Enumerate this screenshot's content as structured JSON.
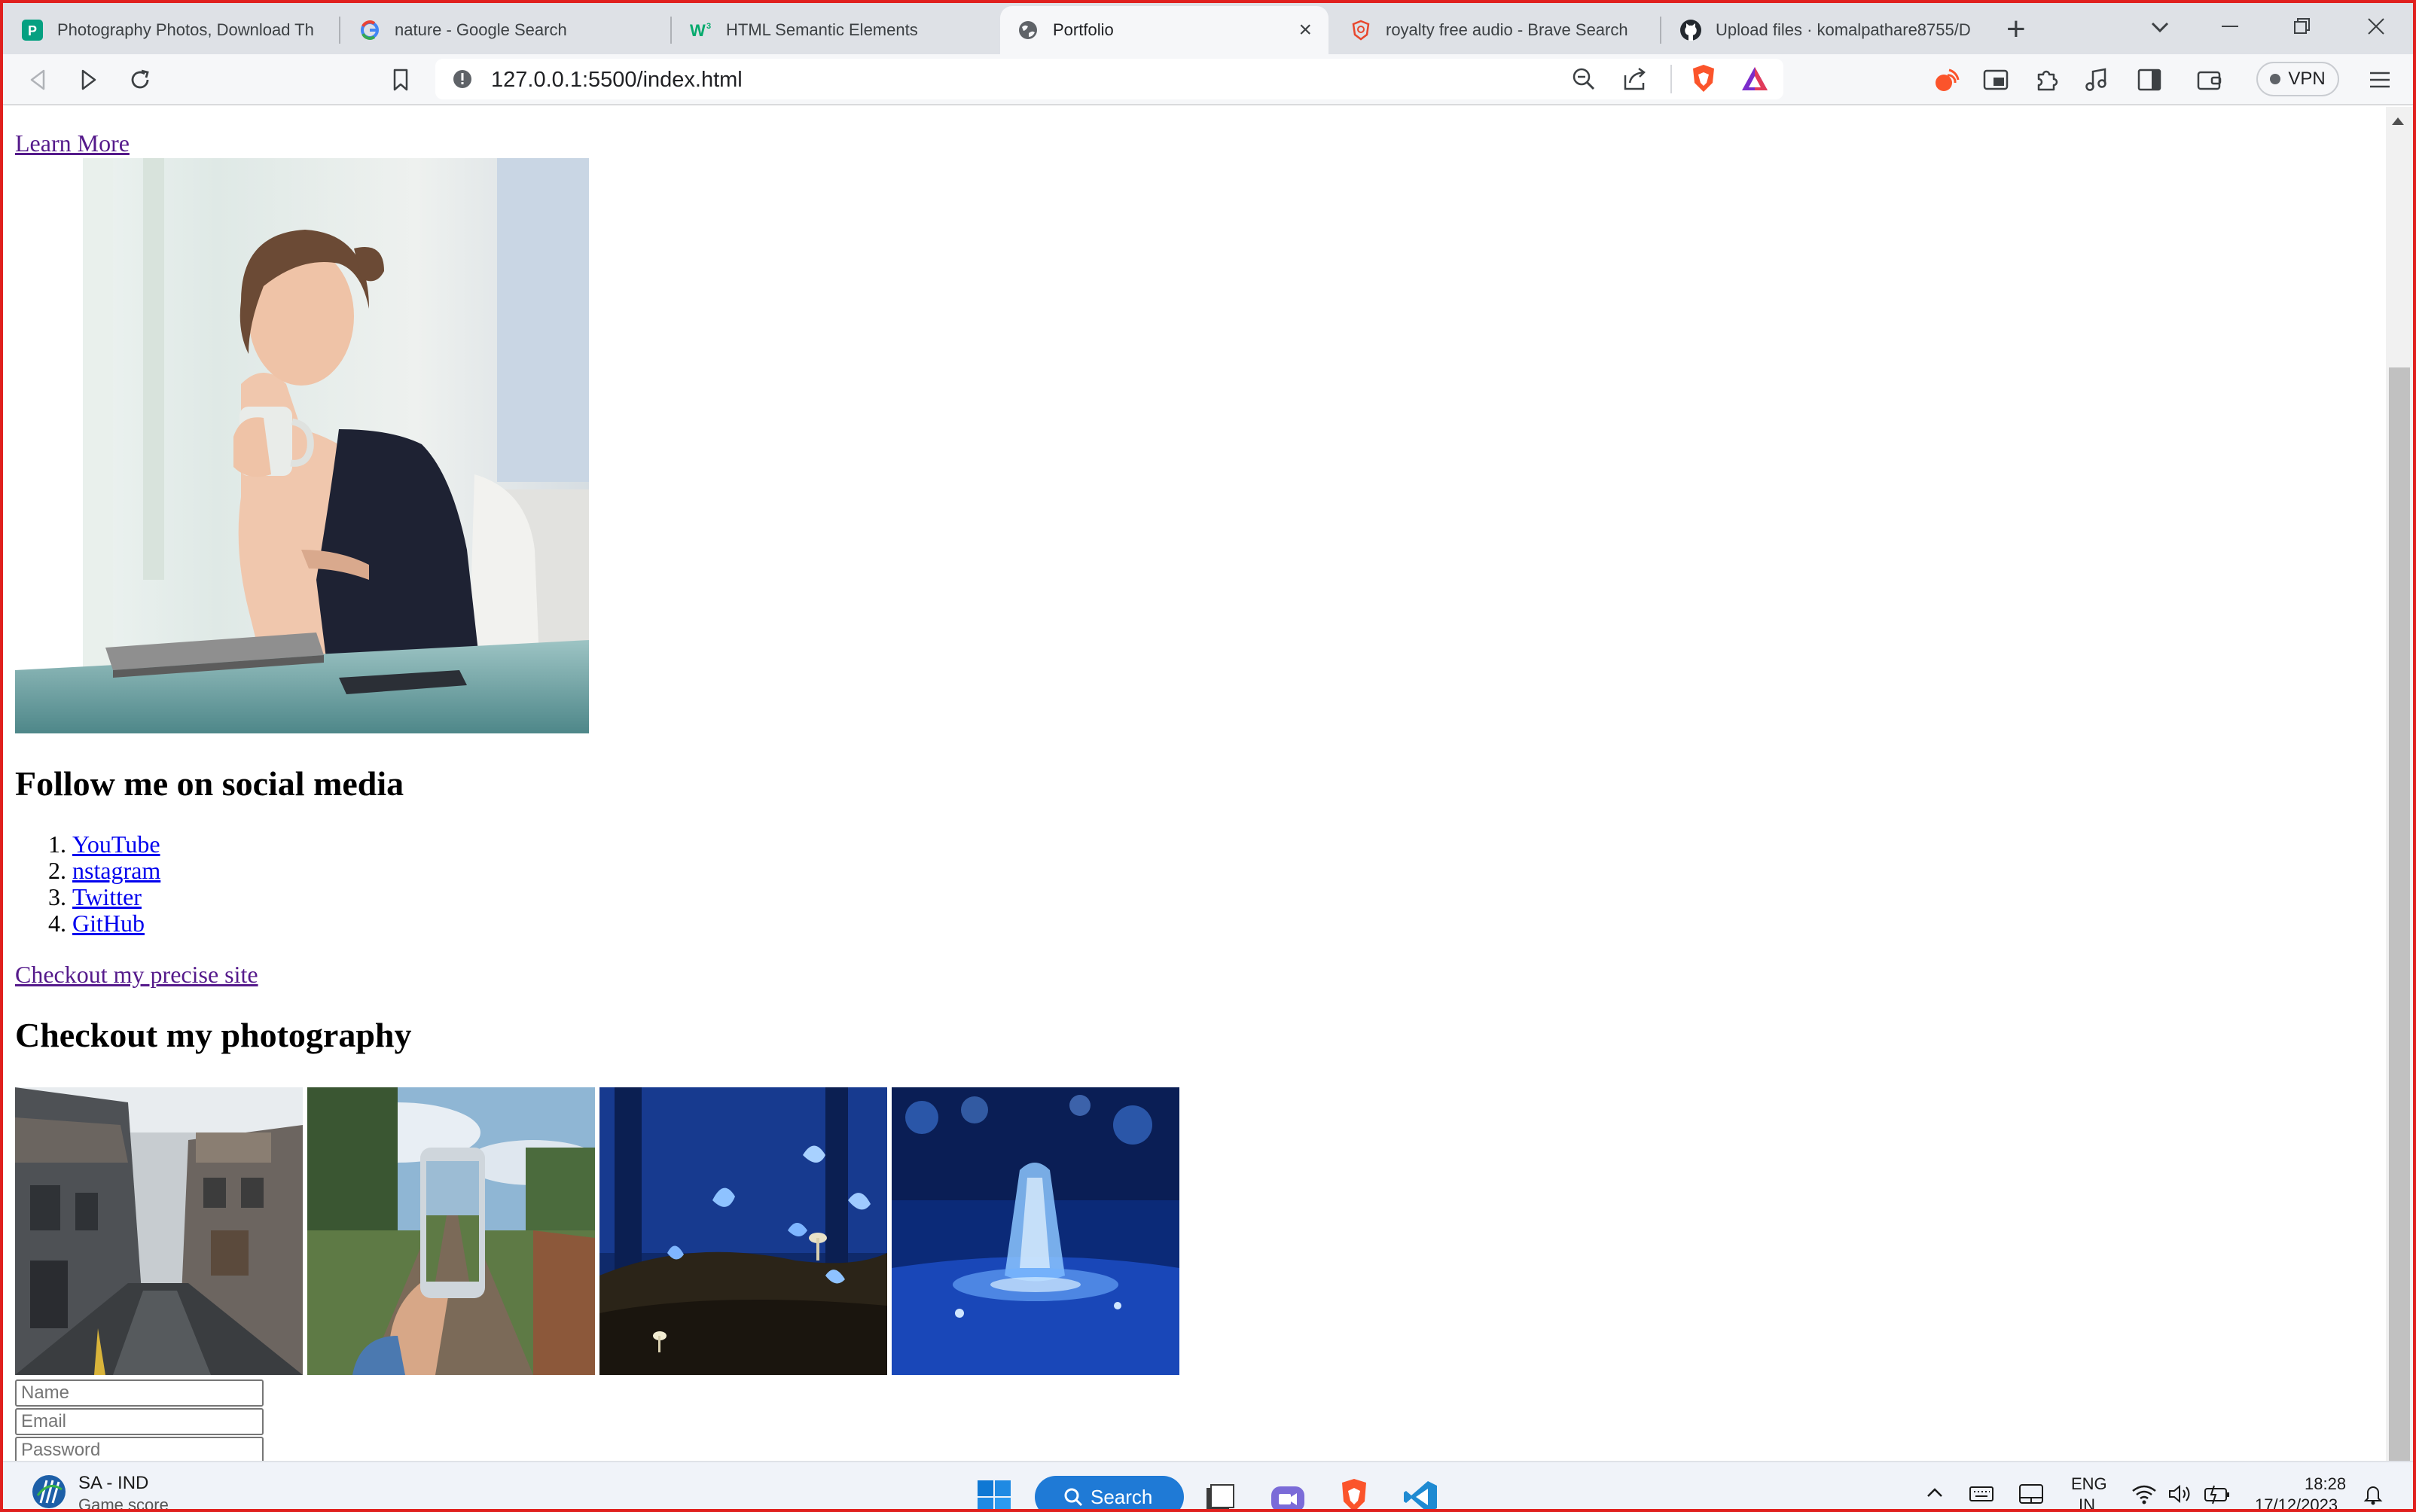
{
  "browser": {
    "tabs": [
      {
        "title": "Photography Photos, Download Th",
        "icon": "pexels-icon",
        "active": false
      },
      {
        "title": "nature - Google Search",
        "icon": "google-icon",
        "active": false
      },
      {
        "title": "HTML Semantic Elements",
        "icon": "w3schools-icon",
        "active": false
      },
      {
        "title": "Portfolio",
        "icon": "globe-icon",
        "active": true
      },
      {
        "title": "royalty free audio - Brave Search",
        "icon": "brave-search-icon",
        "active": false
      },
      {
        "title": "Upload files · komalpathare8755/D",
        "icon": "github-icon",
        "active": false
      }
    ],
    "url": "127.0.0.1:5500/index.html",
    "vpn_label": "VPN",
    "accent": "#fb542b"
  },
  "page": {
    "learn_more": "Learn More",
    "social_heading": "Follow me on social media",
    "social_links": [
      "YouTube",
      "nstagram",
      "Twitter",
      "GitHub"
    ],
    "precise_link": "Checkout my precise site",
    "photography_heading": "Checkout my photography",
    "photos": [
      "city-alley-photo",
      "phone-railway-photo",
      "blue-butterflies-photo",
      "blue-water-fountain-photo"
    ],
    "form": {
      "name_placeholder": "Name",
      "email_placeholder": "Email",
      "password_placeholder": "Password"
    }
  },
  "taskbar": {
    "weather_title": "SA - IND",
    "weather_sub": "Game score",
    "search_label": "Search",
    "language": "ENG",
    "region": "IN",
    "time": "18:28",
    "date": "17/12/2023"
  }
}
